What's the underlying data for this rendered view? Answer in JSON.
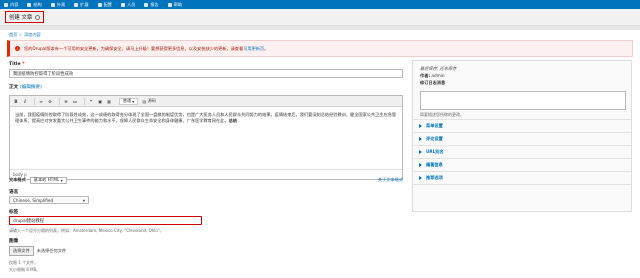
{
  "toolbar": {
    "items": [
      {
        "label": "内容",
        "icon": "content-icon"
      },
      {
        "label": "结构",
        "icon": "structure-icon"
      },
      {
        "label": "外观",
        "icon": "appearance-icon"
      },
      {
        "label": "扩展",
        "icon": "extend-icon"
      },
      {
        "label": "配置",
        "icon": "configuration-icon"
      },
      {
        "label": "人员",
        "icon": "people-icon"
      },
      {
        "label": "报告",
        "icon": "reports-icon"
      },
      {
        "label": "帮助",
        "icon": "help-icon"
      }
    ]
  },
  "header": {
    "title": "创建 文章"
  },
  "breadcrumb": {
    "home": "首页",
    "separator": "»",
    "current": "添加内容"
  },
  "alert": {
    "text": "您的Drupal版本有一个可用的安全更新。为确保安全，请马上升级！要想获得更多信息，以及安装缺少的更新，请查看",
    "link": "可用更新页"
  },
  "form": {
    "title_label": "Title",
    "required_mark": "*",
    "title_value": "我国疫情防控取得了阶段性成效",
    "body_label": "正文",
    "body_edit_summary": "(编辑摘要)",
    "editor_toolbar": {
      "bold": "B",
      "italic": "I",
      "link": "∞",
      "unlink": "⊘",
      "bullet_list": "≡",
      "numbered_list": "≔",
      "blockquote": "❝",
      "image": "▣",
      "table": "▦",
      "format_select": "普通",
      "source": "源码"
    },
    "body_text": "当前，我国疫情防控取得了阶段性成效，这一成绩的取得充分体现了全国一盘棋的制度优势，也是广大医务人员和人民群众共同努力的结果。疫情结束后，我们要深刻总结经验教训，健全国家公共卫生应急管理体系，提高应对突发重大公共卫生事件的能力和水平，保障人民群众生命安全和身体健康，广东医学教育网在此，",
    "body_highlight": "总结",
    "editor_status": "body  p",
    "text_format_label": "文本格式",
    "text_format_value": "基本的 HTML",
    "text_format_help": "关于文本格式",
    "language_label": "语言",
    "language_value": "Chinese, Simplified",
    "tags_label": "标签",
    "tags_value": "drupal建站教程",
    "tags_desc": "请输入一个逗号分隔的列表。例如：Amsterdam, Mexico City, \"Cleveland, Ohio\"。",
    "image_label": "图像",
    "file_button": "选择文件",
    "file_none": "未选择任何文件",
    "image_desc_1": "仅限 1 个文件。",
    "image_desc_2": "大小限制 8 MB。"
  },
  "sidebar": {
    "last_saved_label": "最后保存:",
    "last_saved_value": "还未保存",
    "author_label": "作者:",
    "author_value": "admin",
    "revision_log_label": "修订日志消息",
    "revision_hint": "简要描述您所做的更改。",
    "sections": [
      "菜单设置",
      "评论设置",
      "URL别名",
      "编著信息",
      "推荐选项"
    ]
  }
}
